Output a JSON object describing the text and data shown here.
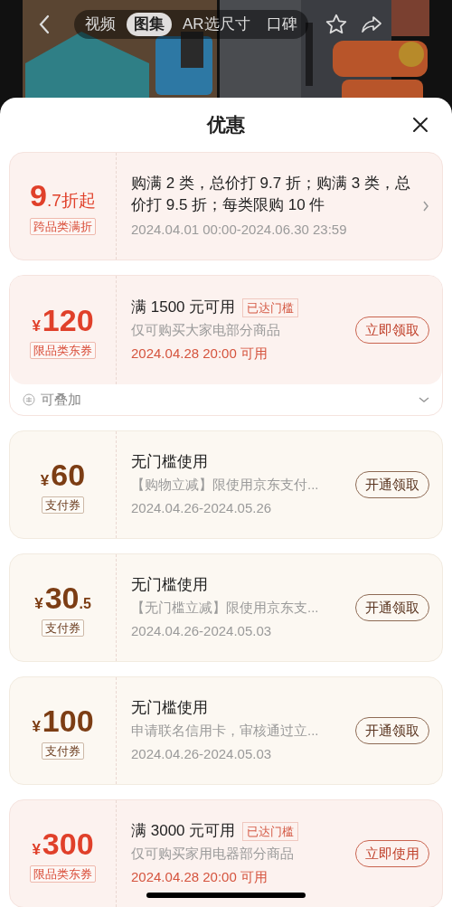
{
  "top_nav": {
    "tabs": [
      {
        "label": "视频",
        "selected": false
      },
      {
        "label": "图集",
        "selected": true
      },
      {
        "label": "AR选尺寸",
        "selected": false
      },
      {
        "label": "口碑",
        "selected": false
      }
    ]
  },
  "sheet": {
    "title": "优惠",
    "coupons": [
      {
        "kind": "discount",
        "amount": "9",
        "amount_suffix": ".7折起",
        "tag": "跨品类满折",
        "title": "购满 2 类，总价打 9.7 折；购满 3 类，总价打 9.5 折；每类限购 10 件",
        "date": "2024.04.01 00:00-2024.06.30 23:59"
      },
      {
        "kind": "category",
        "currency": "¥",
        "amount": "120",
        "tag": "限品类东券",
        "title": "满 1500 元可用",
        "title_badge": "已达门槛",
        "description": "仅可购买大家电部分商品",
        "date": "2024.04.28 20:00 可用",
        "button": "立即领取",
        "footer": {
          "label": "可叠加",
          "expanded": false
        }
      },
      {
        "kind": "payment",
        "currency": "¥",
        "amount": "60",
        "tag": "支付券",
        "title": "无门槛使用",
        "description": "【购物立减】限使用京东支付...",
        "date": "2024.04.26-2024.05.26",
        "button": "开通领取"
      },
      {
        "kind": "payment",
        "currency": "¥",
        "amount": "30",
        "amount_suffix": ".5",
        "tag": "支付券",
        "title": "无门槛使用",
        "description": "【无门槛立减】限使用京东支...",
        "date": "2024.04.26-2024.05.03",
        "button": "开通领取"
      },
      {
        "kind": "payment",
        "currency": "¥",
        "amount": "100",
        "tag": "支付券",
        "title": "无门槛使用",
        "description": "申请联名信用卡，审核通过立...",
        "date": "2024.04.26-2024.05.03",
        "button": "开通领取"
      },
      {
        "kind": "category",
        "currency": "¥",
        "amount": "300",
        "tag": "限品类东券",
        "title": "满 3000 元可用",
        "title_badge": "已达门槛",
        "description": "仅可购买家用电器部分商品",
        "date": "2024.04.28 20:00 可用",
        "button": "立即使用"
      }
    ]
  }
}
